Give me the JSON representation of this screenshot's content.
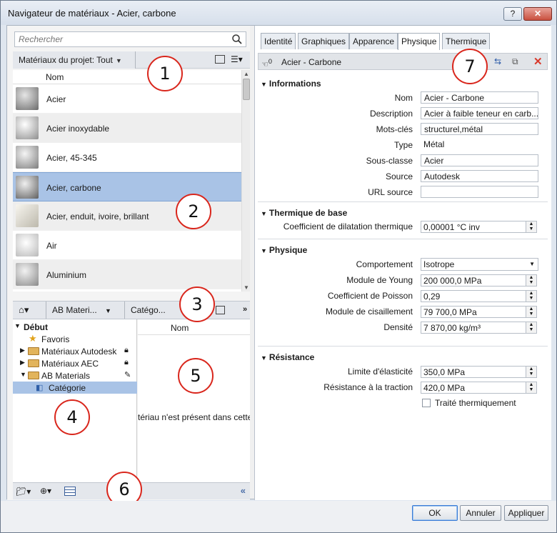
{
  "window": {
    "title": "Navigateur de matériaux - Acier, carbone",
    "help_label": "?",
    "close_label": "✕"
  },
  "search": {
    "placeholder": "Rechercher"
  },
  "project": {
    "filter_label": "Matériaux du projet: Tout",
    "column_name": "Nom",
    "materials": [
      {
        "name": "Acier",
        "color": "#9a9a9a"
      },
      {
        "name": "Acier inoxydable",
        "color": "#c9c9c9"
      },
      {
        "name": "Acier, 45-345",
        "color": "#b5b5b5"
      },
      {
        "name": "Acier, carbone",
        "color": "#a5a5a5",
        "selected": true
      },
      {
        "name": "Acier, enduit, ivoire, brillant",
        "color": "#d9d6cc"
      },
      {
        "name": "Air",
        "color": "#cfcfcf"
      },
      {
        "name": "Aluminium",
        "color": "#bdbdbd"
      }
    ]
  },
  "library": {
    "home_icon": "home-icon",
    "crumbs": [
      "AB Materi...",
      "Catégo..."
    ],
    "overflow": "»",
    "tree": [
      {
        "label": "Début",
        "level": 0,
        "type": "root"
      },
      {
        "label": "Favoris",
        "level": 1,
        "type": "favorite"
      },
      {
        "label": "Matériaux Autodesk",
        "level": 1,
        "type": "folder",
        "locked": true
      },
      {
        "label": "Matériaux AEC",
        "level": 1,
        "type": "folder",
        "locked": true
      },
      {
        "label": "AB Materials",
        "level": 1,
        "type": "folder",
        "editable": true
      },
      {
        "label": "Catégorie",
        "level": 2,
        "type": "category",
        "selected": true
      }
    ],
    "column_name": "Nom",
    "empty_text": "tériau n'est présent dans cette"
  },
  "tabs": [
    "Identité",
    "Graphiques",
    "Apparence",
    "Physique",
    "Thermique"
  ],
  "active_tab": "Physique",
  "asset": {
    "name": "Acier - Carbone",
    "users": "0"
  },
  "sections": {
    "informations": {
      "title": "Informations",
      "nom_label": "Nom",
      "nom": "Acier - Carbone",
      "description_label": "Description",
      "description": "Acier à faible teneur en carb...",
      "mots_label": "Mots-clés",
      "mots": "structurel,métal",
      "type_label": "Type",
      "type": "Métal",
      "sousclasse_label": "Sous-classe",
      "sousclasse": "Acier",
      "source_label": "Source",
      "source": "Autodesk",
      "url_label": "URL source",
      "url": ""
    },
    "thermique": {
      "title": "Thermique de base",
      "coef_label": "Coefficient de dilatation thermique",
      "coef": "0,00001 °C inv"
    },
    "physique": {
      "title": "Physique",
      "comportement_label": "Comportement",
      "comportement": "Isotrope",
      "young_label": "Module de Young",
      "young": "200 000,0 MPa",
      "poisson_label": "Coefficient de Poisson",
      "poisson": "0,29",
      "cisaillement_label": "Module de cisaillement",
      "cisaillement": "79 700,0 MPa",
      "densite_label": "Densité",
      "densite": "7 870,00 kg/m³"
    },
    "resistance": {
      "title": "Résistance",
      "elasticite_label": "Limite d'élasticité",
      "elasticite": "350,0 MPa",
      "traction_label": "Résistance à la traction",
      "traction": "420,0 MPa",
      "traite_label": "Traité thermiquement"
    }
  },
  "callouts": [
    "1",
    "2",
    "3",
    "4",
    "5",
    "6",
    "7"
  ],
  "buttons": {
    "ok": "OK",
    "cancel": "Annuler",
    "apply": "Appliquer"
  }
}
